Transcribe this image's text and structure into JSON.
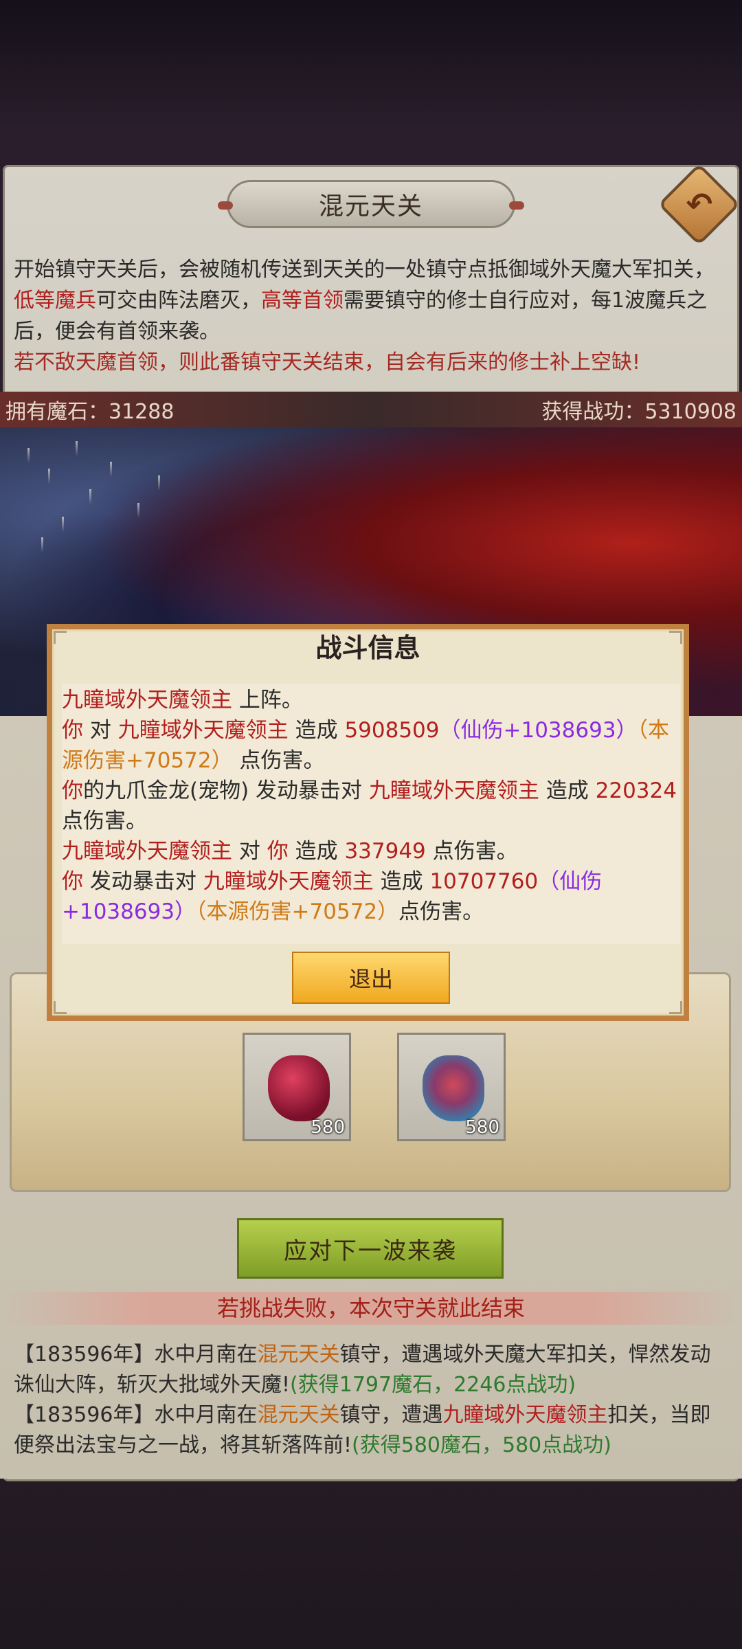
{
  "header": {
    "title": "混元天关",
    "back_icon": "back-arrow-icon"
  },
  "intro": {
    "line1_a": "开始镇守天关后，会被随机传送到天关的一处镇守点抵御域外天魔大军扣关，",
    "line1_b": "低等魔兵",
    "line1_c": "可交由阵法磨灭，",
    "line1_d": "高等首领",
    "line1_e": "需要镇守的修士自行应对，每1波魔兵之后，便会有首领来袭。",
    "line2": "若不敌天魔首领，则此番镇守天关结束，自会有后来的修士补上空缺!"
  },
  "stats": {
    "stones_label": "拥有魔石：31288",
    "merit_label": "获得战功：5310908"
  },
  "rewards": [
    {
      "icon": "red-gem-icon",
      "count": "580"
    },
    {
      "icon": "rune-stone-icon",
      "count": "580"
    }
  ],
  "next_button": "应对下一波来袭",
  "warning": "若挑战失败，本次守关就此结束",
  "log": {
    "e1_a": "【183596年】水中月南在",
    "e1_place": "混元天关",
    "e1_b": "镇守，遭遇域外天魔大军扣关，悍然发动诛仙大阵，斩灭大批域外天魔!",
    "e1_gain": "(获得1797魔石，2246点战功)",
    "e2_a": "【183596年】水中月南在",
    "e2_place": "混元天关",
    "e2_b": "镇守，遭遇",
    "e2_boss": "九瞳域外天魔领主",
    "e2_c": "扣关，当即便祭出法宝与之一战，将其斩落阵前!",
    "e2_gain": "(获得580魔石，580点战功)"
  },
  "modal": {
    "title": "战斗信息",
    "l1_boss": "九瞳域外天魔领主",
    "l1_text": " 上阵。",
    "l2_you": "你",
    "l2_a": " 对 ",
    "l2_boss": "九瞳域外天魔领主",
    "l2_b": " 造成 ",
    "l2_dmg": "5908509",
    "l2_xian": "（仙伤+1038693）",
    "l2_yuan": "（本源伤害+70572）",
    "l2_end": " 点伤害。",
    "l3_you": "你",
    "l3_a": "的九爪金龙(宠物) 发动暴击对 ",
    "l3_boss": "九瞳域外天魔领主",
    "l3_b": " 造成 ",
    "l3_dmg": "220324",
    "l3_end": " 点伤害。",
    "l4_boss": "九瞳域外天魔领主",
    "l4_a": " 对 ",
    "l4_you": "你",
    "l4_b": " 造成 ",
    "l4_dmg": "337949",
    "l4_end": " 点伤害。",
    "l5_you": "你",
    "l5_a": " 发动暴击对 ",
    "l5_boss": "九瞳域外天魔领主",
    "l5_b": " 造成 ",
    "l5_dmg": "10707760",
    "l5_xian": "（仙伤+1038693）",
    "l5_yuan": "（本源伤害+70572）",
    "l5_end": "点伤害。",
    "exit_button": "退出"
  }
}
